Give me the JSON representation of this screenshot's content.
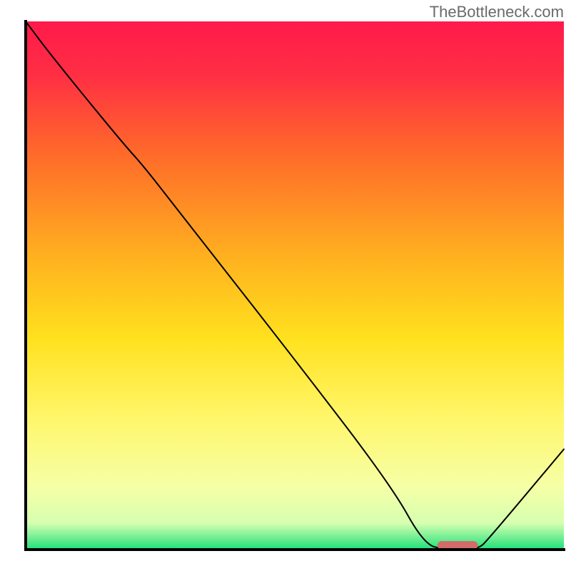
{
  "watermark": "TheBottleneck.com",
  "chart_data": {
    "type": "line",
    "title": "",
    "xlabel": "",
    "ylabel": "",
    "xlim": [
      0,
      100
    ],
    "ylim": [
      0,
      100
    ],
    "axes_visible": false,
    "grid": false,
    "gradient_stops": [
      {
        "offset": 0.0,
        "color": "#ff1a4b"
      },
      {
        "offset": 0.1,
        "color": "#ff2e44"
      },
      {
        "offset": 0.25,
        "color": "#ff6a2a"
      },
      {
        "offset": 0.45,
        "color": "#ffb21f"
      },
      {
        "offset": 0.6,
        "color": "#ffe11e"
      },
      {
        "offset": 0.75,
        "color": "#fff66a"
      },
      {
        "offset": 0.88,
        "color": "#f6ffa6"
      },
      {
        "offset": 0.95,
        "color": "#d6ffb0"
      },
      {
        "offset": 1.0,
        "color": "#1ee07a"
      }
    ],
    "series": [
      {
        "name": "bottleneck-curve",
        "color": "#000000",
        "stroke_width": 2,
        "x": [
          0.0,
          5.0,
          18.0,
          22.0,
          30.0,
          50.0,
          68.0,
          74.0,
          78.0,
          84.0,
          86.0,
          100.0
        ],
        "values": [
          100.0,
          93.2,
          77.0,
          72.5,
          62.0,
          36.0,
          12.0,
          1.0,
          0.0,
          0.0,
          2.0,
          19.0
        ]
      }
    ],
    "marker": {
      "name": "optimal-range-marker",
      "color": "#d46a6a",
      "x_start": 76.5,
      "x_end": 84.0,
      "y": 0.0,
      "thickness": 1.6
    },
    "frame": {
      "stroke": "#000000",
      "stroke_width": 4,
      "sides": [
        "left",
        "bottom"
      ]
    }
  }
}
